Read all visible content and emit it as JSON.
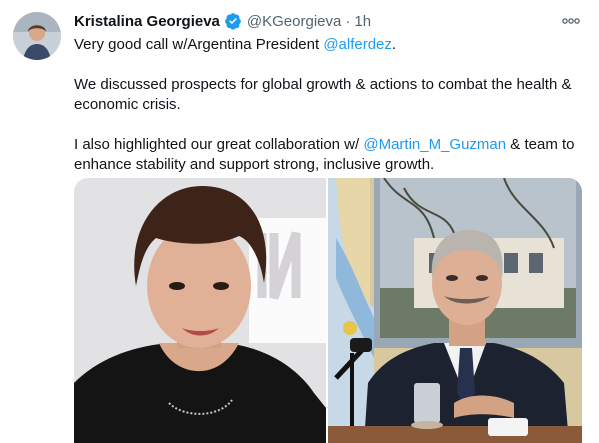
{
  "tweet": {
    "author": {
      "name": "Kristalina Georgieva",
      "handle": "@KGeorgieva",
      "separator": "·",
      "time": "1h",
      "verified": true,
      "avatar_icon": "avatar-photo"
    },
    "more_icon": "more-horizontal-icon",
    "text": {
      "p1_prefix": "Very good call w/Argentina President ",
      "p1_mention": "@alferdez",
      "p1_suffix": ".",
      "p2": "We discussed prospects for global growth & actions to combat the health & economic crisis.",
      "p3_prefix": "I also highlighted our great collaboration w/ ",
      "p3_mention": "@Martin_M_Guzman",
      "p3_suffix": " & team to enhance stability and support strong, inclusive growth."
    },
    "media": {
      "left_photo": "video-call-woman",
      "right_photo": "video-call-man-at-desk"
    }
  },
  "colors": {
    "link": "#1d9bf0",
    "verified": "#1d9bf0",
    "secondary_text": "#536471",
    "primary_text": "#0f1419"
  }
}
